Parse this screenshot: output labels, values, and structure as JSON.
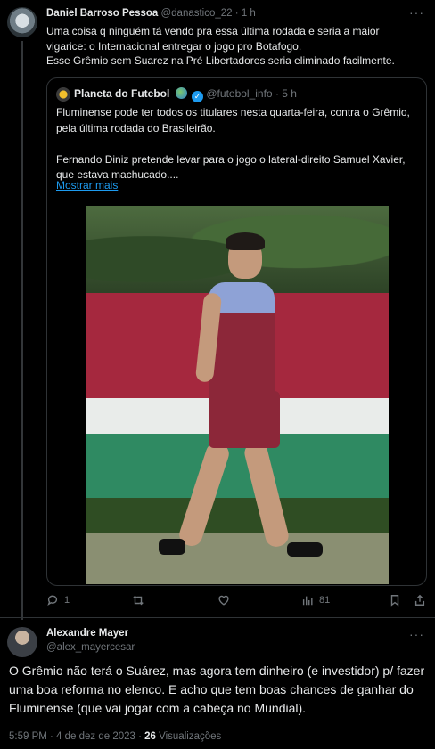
{
  "tweet1": {
    "name": "Daniel Barroso Pessoa",
    "handle": "@danastico_22",
    "time": "1 h",
    "text_lines": [
      "Uma coisa q ninguém tá vendo pra essa última rodada e seria a maior",
      "vigarice: o Internacional entregar o jogo pro Botafogo.",
      "Esse Grêmio sem Suarez na Pré Libertadores seria eliminado facilmente."
    ],
    "quote": {
      "name": "Planeta do Futebol",
      "handle": "@futebol_info",
      "time": "5 h",
      "para1": "Fluminense pode ter todos os titulares nesta quarta-feira, contra o Grêmio, pela última rodada do Brasileirão.",
      "para2": "Fernando Diniz pretende levar para o jogo o lateral-direito Samuel Xavier, que estava machucado....",
      "show_more": "Mostrar mais"
    },
    "actions": {
      "reply_count": "1",
      "views_count": "81"
    }
  },
  "tweet2": {
    "name": "Alexandre Mayer",
    "handle": "@alex_mayercesar",
    "text": "O Grêmio não terá o Suárez, mas agora tem dinheiro (e investidor) p/ fazer uma boa reforma no elenco. E acho que tem boas chances de ganhar do Fluminense (que vai jogar com a cabeça no Mundial).",
    "timestamp": "5:59 PM · 4 de dez de 2023 · ",
    "views_count": "26",
    "views_label": " Visualizações"
  },
  "separator": "·",
  "more_glyph": "···"
}
